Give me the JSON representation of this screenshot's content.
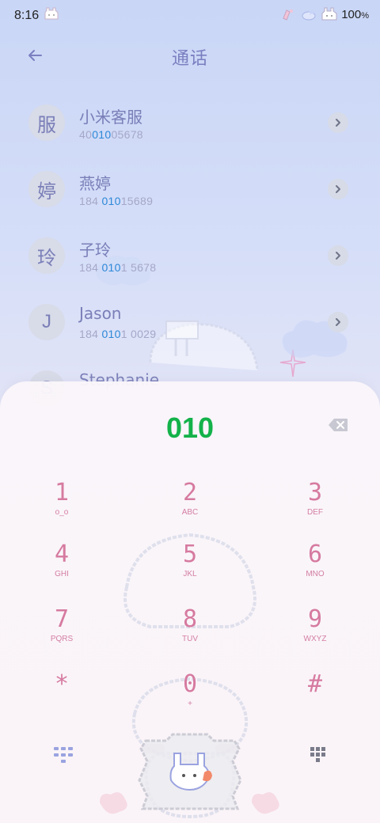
{
  "status_bar": {
    "time": "8:16",
    "battery": "100",
    "battery_unit": "%"
  },
  "header": {
    "title": "通话",
    "back_icon": "arrow-left-icon"
  },
  "contacts": [
    {
      "avatar": "服",
      "name": "小米客服",
      "num_pre": "40",
      "num_hl": "010",
      "num_post": "05678"
    },
    {
      "avatar": "婷",
      "name": "燕婷",
      "num_pre": "184 ",
      "num_hl": "010",
      "num_post": "15689"
    },
    {
      "avatar": "玲",
      "name": "子玲",
      "num_pre": "184 ",
      "num_hl": "010",
      "num_post": "1 5678"
    },
    {
      "avatar": "J",
      "name": "Jason",
      "num_pre": "184 ",
      "num_hl": "010",
      "num_post": "1 0029"
    },
    {
      "avatar": "S",
      "name": "Stephanie",
      "num_pre": "",
      "num_hl": "",
      "num_post": ""
    }
  ],
  "dialer": {
    "number": "010",
    "keys": [
      {
        "digit": "1",
        "letters": "o_o"
      },
      {
        "digit": "2",
        "letters": "ABC"
      },
      {
        "digit": "3",
        "letters": "DEF"
      },
      {
        "digit": "4",
        "letters": "GHI"
      },
      {
        "digit": "5",
        "letters": "JKL"
      },
      {
        "digit": "6",
        "letters": "MNO"
      },
      {
        "digit": "7",
        "letters": "PQRS"
      },
      {
        "digit": "8",
        "letters": "TUV"
      },
      {
        "digit": "9",
        "letters": "WXYZ"
      },
      {
        "digit": "*",
        "letters": ""
      },
      {
        "digit": "0",
        "letters": "+"
      },
      {
        "digit": "#",
        "letters": ""
      }
    ]
  },
  "colors": {
    "accent_green": "#13b24a",
    "highlight_blue": "#2d88d8",
    "key_pink": "#d67aa0",
    "text_purple": "#7a7fb8"
  }
}
